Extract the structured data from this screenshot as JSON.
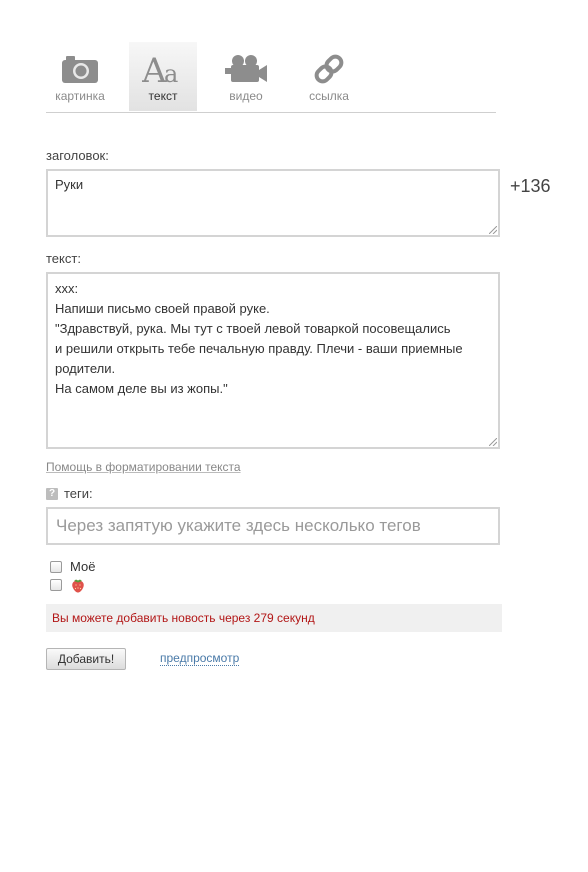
{
  "tabs": [
    {
      "label": "картинка",
      "icon": "camera-icon"
    },
    {
      "label": "текст",
      "icon": "text-aa-icon"
    },
    {
      "label": "видео",
      "icon": "video-camera-icon"
    },
    {
      "label": "ссылка",
      "icon": "link-icon"
    }
  ],
  "active_tab": "текст",
  "title_field": {
    "label": "заголовок:",
    "value": "Руки",
    "counter": "+136"
  },
  "text_field": {
    "label": "текст:",
    "lines": [
      "ххх:",
      "Напиши письмо своей правой руке.",
      "\"Здравствуй, рука. Мы тут с твоей левой товаркой посовещались",
      "и решили открыть тебе печальную правду. Плечи - ваши приемные",
      "родители.",
      "На самом деле вы из жопы.\""
    ]
  },
  "help_link": "Помощь в форматировании текста",
  "tags": {
    "help_icon": "?",
    "label": "теги:",
    "placeholder": "Через запятую укажите здесь несколько тегов"
  },
  "options": {
    "mine_label": "Моё",
    "strawberry_icon": "strawberry-icon"
  },
  "notice": "Вы можете добавить новость через 279 секунд",
  "actions": {
    "submit_label": "Добавить!",
    "preview_label": "предпросмотр"
  },
  "colors": {
    "notice_text": "#b21616",
    "link": "#4a7aa8",
    "icon_gray": "#8d8d8d"
  }
}
